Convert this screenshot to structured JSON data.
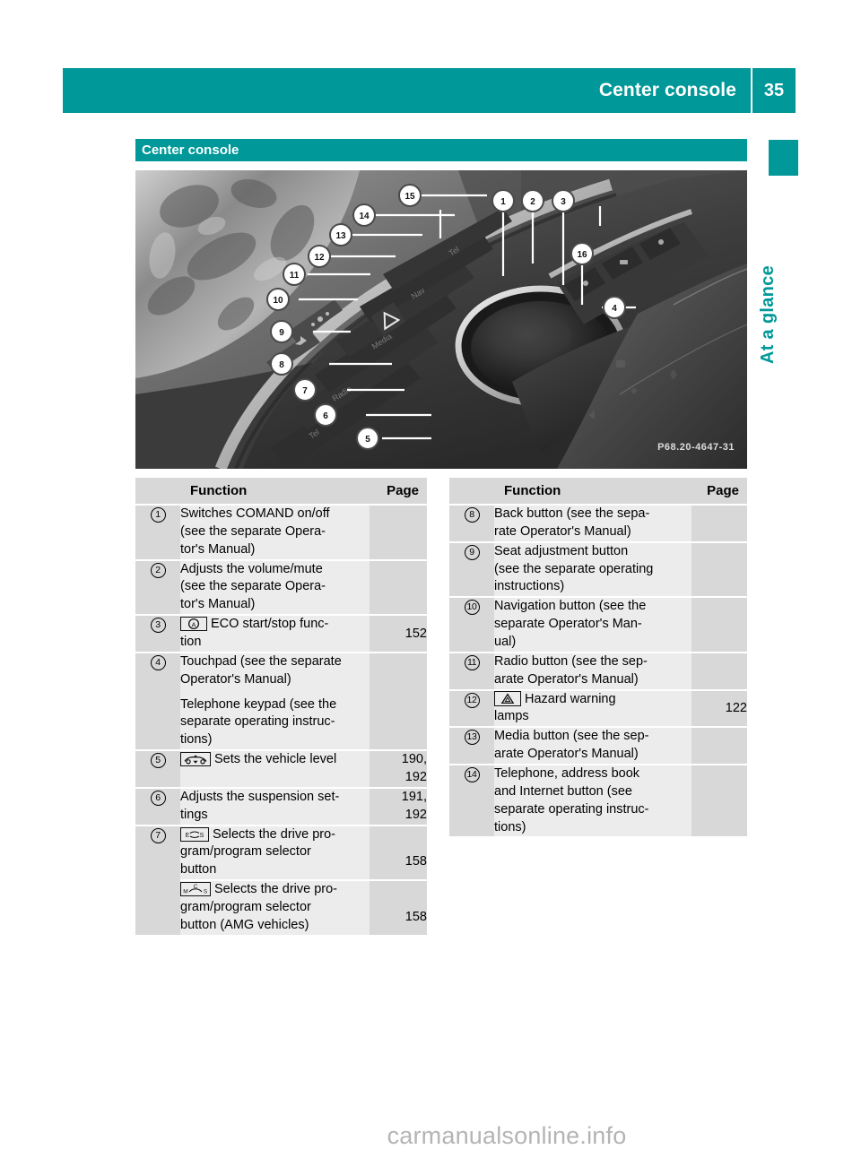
{
  "header": {
    "title": "Center console",
    "page_number": "35"
  },
  "side_tab": {
    "label": "At a glance",
    "accent_color": "#009898"
  },
  "section": {
    "title": "Center console"
  },
  "photo": {
    "caption_code": "P68.20-4647-31",
    "callouts": [
      "1",
      "2",
      "3",
      "4",
      "5",
      "6",
      "7",
      "8",
      "9",
      "10",
      "11",
      "12",
      "13",
      "14",
      "15",
      "16"
    ]
  },
  "table_left": {
    "headers": {
      "number": "",
      "function": "Function",
      "page": "Page"
    },
    "rows": [
      {
        "num": "1",
        "icon": "",
        "lines": [
          "Switches COMAND on/off\n(see the separate Opera-\ntor's Manual)"
        ],
        "page": ""
      },
      {
        "num": "2",
        "icon": "",
        "lines": [
          "Adjusts the volume/mute\n(see the separate Opera-\ntor's Manual)"
        ],
        "page": ""
      },
      {
        "num": "3",
        "icon": "eco-start-stop-icon",
        "lines": [
          "ECO start/stop func-\ntion"
        ],
        "page": "152"
      },
      {
        "num": "4",
        "icon": "",
        "lines": [
          "Touchpad (see the separate\nOperator's Manual)",
          "Telephone keypad (see the\nseparate operating instruc-\ntions)"
        ],
        "page": ""
      },
      {
        "num": "5",
        "icon": "vehicle-level-icon",
        "lines": [
          "Sets the vehicle level"
        ],
        "page": "190,\n192"
      },
      {
        "num": "6",
        "icon": "",
        "lines": [
          "Adjusts the suspension set-\ntings"
        ],
        "page": "191,\n192"
      },
      {
        "num": "7",
        "icon": "drive-program-icon",
        "lines": [
          "Selects the drive pro-\ngram/program selector\nbutton"
        ],
        "page": "158"
      },
      {
        "num": "",
        "icon": "amg-drive-program-icon",
        "lines": [
          "Selects the drive pro-\ngram/program selector\nbutton (AMG vehicles)"
        ],
        "page": "158"
      }
    ]
  },
  "table_right": {
    "headers": {
      "number": "",
      "function": "Function",
      "page": "Page"
    },
    "rows": [
      {
        "num": "8",
        "icon": "",
        "lines": [
          "Back button (see the sepa-\nrate Operator's Manual)"
        ],
        "page": ""
      },
      {
        "num": "9",
        "icon": "",
        "lines": [
          "Seat adjustment button\n(see the separate operating\ninstructions)"
        ],
        "page": ""
      },
      {
        "num": "10",
        "icon": "",
        "lines": [
          "Navigation button (see the\nseparate Operator's Man-\nual)"
        ],
        "page": ""
      },
      {
        "num": "11",
        "icon": "",
        "lines": [
          "Radio button (see the sep-\narate Operator's Manual)"
        ],
        "page": ""
      },
      {
        "num": "12",
        "icon": "hazard-warning-icon",
        "lines": [
          "Hazard warning\nlamps"
        ],
        "page": "122"
      },
      {
        "num": "13",
        "icon": "",
        "lines": [
          "Media button (see the sep-\narate Operator's Manual)"
        ],
        "page": ""
      },
      {
        "num": "14",
        "icon": "",
        "lines": [
          "Telephone, address book\nand Internet button (see\nseparate operating instruc-\ntions)"
        ],
        "page": ""
      }
    ]
  },
  "watermark": {
    "text": "carmanualsonline.info"
  }
}
